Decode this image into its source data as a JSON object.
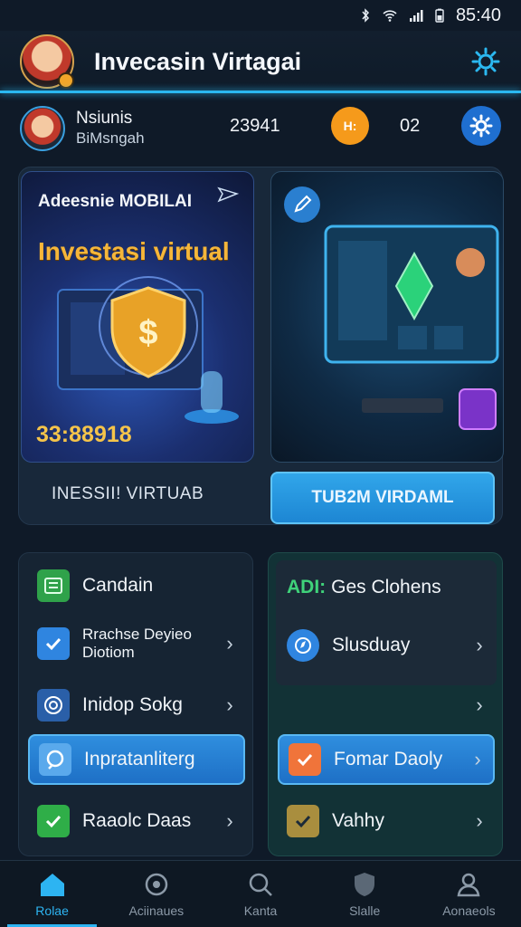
{
  "status_bar": {
    "time": "85:40"
  },
  "header": {
    "title": "Invecasin Virtagai"
  },
  "user": {
    "name": "Nsiunis",
    "subtitle": "BiMsngah",
    "points": "23941",
    "coin_label": "H:",
    "count": "02"
  },
  "promo": {
    "left": {
      "small_title": "Adeesnie MOBILAI",
      "big_title": "Investasi virtual",
      "amount": "33:88918"
    },
    "footer_label": "INESSII! VIRTUAB",
    "cta_label": "TUB2M VIRDAML"
  },
  "menu_left": {
    "items": [
      {
        "label": "Candain",
        "icon": "ledger-icon",
        "color": "#3cc45a"
      },
      {
        "label": "Rrachse Deyieo\nDiotiom",
        "icon": "checkbox-icon",
        "color": "#2f85e0"
      },
      {
        "label": "Inidop Sokg",
        "icon": "target-icon",
        "color": "#3b8be0"
      },
      {
        "label": "Inpratanliterg",
        "icon": "chat-icon",
        "color": "#eaf4ff"
      },
      {
        "label": "Raaolc Daas",
        "icon": "check-icon",
        "color": "#3cc45a"
      }
    ]
  },
  "menu_right": {
    "header_prefix": "ADI:",
    "header_label": "Ges Clohens",
    "items": [
      {
        "label": "Slusduay",
        "icon": "compass-icon",
        "color": "#2f85e0"
      },
      {
        "label": "",
        "icon": "",
        "color": ""
      },
      {
        "label": "Fomar Daoly",
        "icon": "check-icon",
        "color": "#f0743a"
      },
      {
        "label": "Vahhy",
        "icon": "check-icon",
        "color": "#b9a04a"
      }
    ]
  },
  "bottom_nav": {
    "items": [
      {
        "label": "Rolae",
        "icon": "home-icon"
      },
      {
        "label": "Aciinaues",
        "icon": "robot-icon"
      },
      {
        "label": "Kanta",
        "icon": "search-icon"
      },
      {
        "label": "Slalle",
        "icon": "shield-icon"
      },
      {
        "label": "Aonaeols",
        "icon": "profile-icon"
      }
    ]
  },
  "colors": {
    "accent": "#2db4f2",
    "coin": "#f59a1b",
    "gear": "#1f6fd0"
  }
}
